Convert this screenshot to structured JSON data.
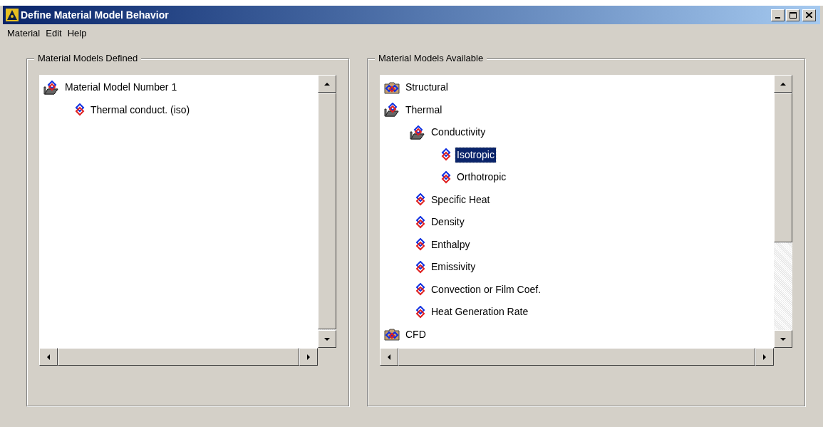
{
  "window": {
    "title": "Define Material Model Behavior"
  },
  "menu": [
    "Material",
    "Edit",
    "Help"
  ],
  "defined": {
    "title": "Material Models Defined",
    "tree": [
      {
        "label": "Material Model Number 1",
        "kind": "folder",
        "expanded": true,
        "children": [
          {
            "label": "Thermal conduct. (iso)",
            "kind": "model"
          }
        ]
      }
    ]
  },
  "available": {
    "title": "Material Models Available",
    "tree": [
      {
        "label": "Structural",
        "kind": "folder",
        "expanded": false,
        "selected": false
      },
      {
        "label": "Thermal",
        "kind": "folder",
        "expanded": true,
        "selected": false,
        "children": [
          {
            "label": "Conductivity",
            "kind": "folder",
            "expanded": true,
            "selected": false,
            "children": [
              {
                "label": "Isotropic",
                "kind": "model",
                "selected": true
              },
              {
                "label": "Orthotropic",
                "kind": "model",
                "selected": false
              }
            ]
          },
          {
            "label": "Specific Heat",
            "kind": "model",
            "selected": false
          },
          {
            "label": "Density",
            "kind": "model",
            "selected": false
          },
          {
            "label": "Enthalpy",
            "kind": "model",
            "selected": false
          },
          {
            "label": "Emissivity",
            "kind": "model",
            "selected": false
          },
          {
            "label": "Convection or Film Coef.",
            "kind": "model",
            "selected": false
          },
          {
            "label": "Heat Generation Rate",
            "kind": "model",
            "selected": false
          }
        ]
      },
      {
        "label": "CFD",
        "kind": "folder",
        "expanded": false,
        "selected": false
      }
    ]
  }
}
